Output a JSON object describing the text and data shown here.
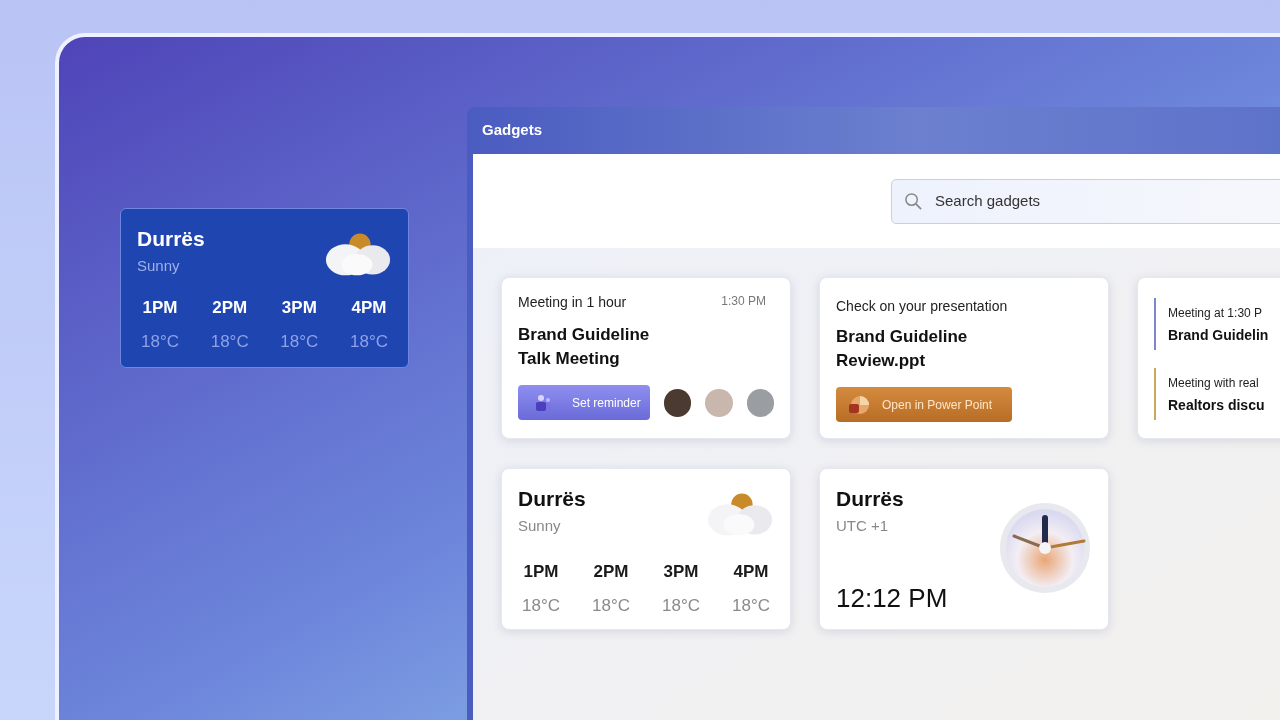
{
  "desktop_widget": {
    "city": "Durrës",
    "condition": "Sunny",
    "forecast": [
      {
        "time": "1PM",
        "temp": "18°C"
      },
      {
        "time": "2PM",
        "temp": "18°C"
      },
      {
        "time": "3PM",
        "temp": "18°C"
      },
      {
        "time": "4PM",
        "temp": "18°C"
      }
    ]
  },
  "window": {
    "title": "Gadgets"
  },
  "search": {
    "placeholder": "Search gadgets"
  },
  "gadgets": [
    {
      "kind": "meeting",
      "subtitle": "Meeting in 1 hour",
      "time": "1:30 PM",
      "title_lines": [
        "Brand Guideline",
        "Talk Meeting"
      ],
      "button": "Set reminder",
      "attendees": [
        {
          "kind": "photo"
        },
        {
          "kind": "photo"
        },
        {
          "kind": "photo"
        }
      ]
    },
    {
      "kind": "document",
      "subtitle": "Check on your presentation",
      "title_lines": [
        "Brand Guideline",
        "Review.ppt"
      ],
      "button": "Open in Power Point"
    },
    {
      "kind": "agenda",
      "events": [
        {
          "subtitle": "Meeting at 1:30 P",
          "title": "Brand Guidelin",
          "color": "#7d86cc"
        },
        {
          "subtitle": "Meeting with real",
          "title": "Realtors discu",
          "color": "#c9a85e"
        }
      ]
    },
    {
      "kind": "weather",
      "city": "Durrës",
      "condition": "Sunny",
      "forecast": [
        {
          "time": "1PM",
          "temp": "18°C"
        },
        {
          "time": "2PM",
          "temp": "18°C"
        },
        {
          "time": "3PM",
          "temp": "18°C"
        },
        {
          "time": "4PM",
          "temp": "18°C"
        }
      ]
    },
    {
      "kind": "clock",
      "city": "Durrës",
      "zone": "UTC +1",
      "time": "12:12 PM"
    }
  ]
}
